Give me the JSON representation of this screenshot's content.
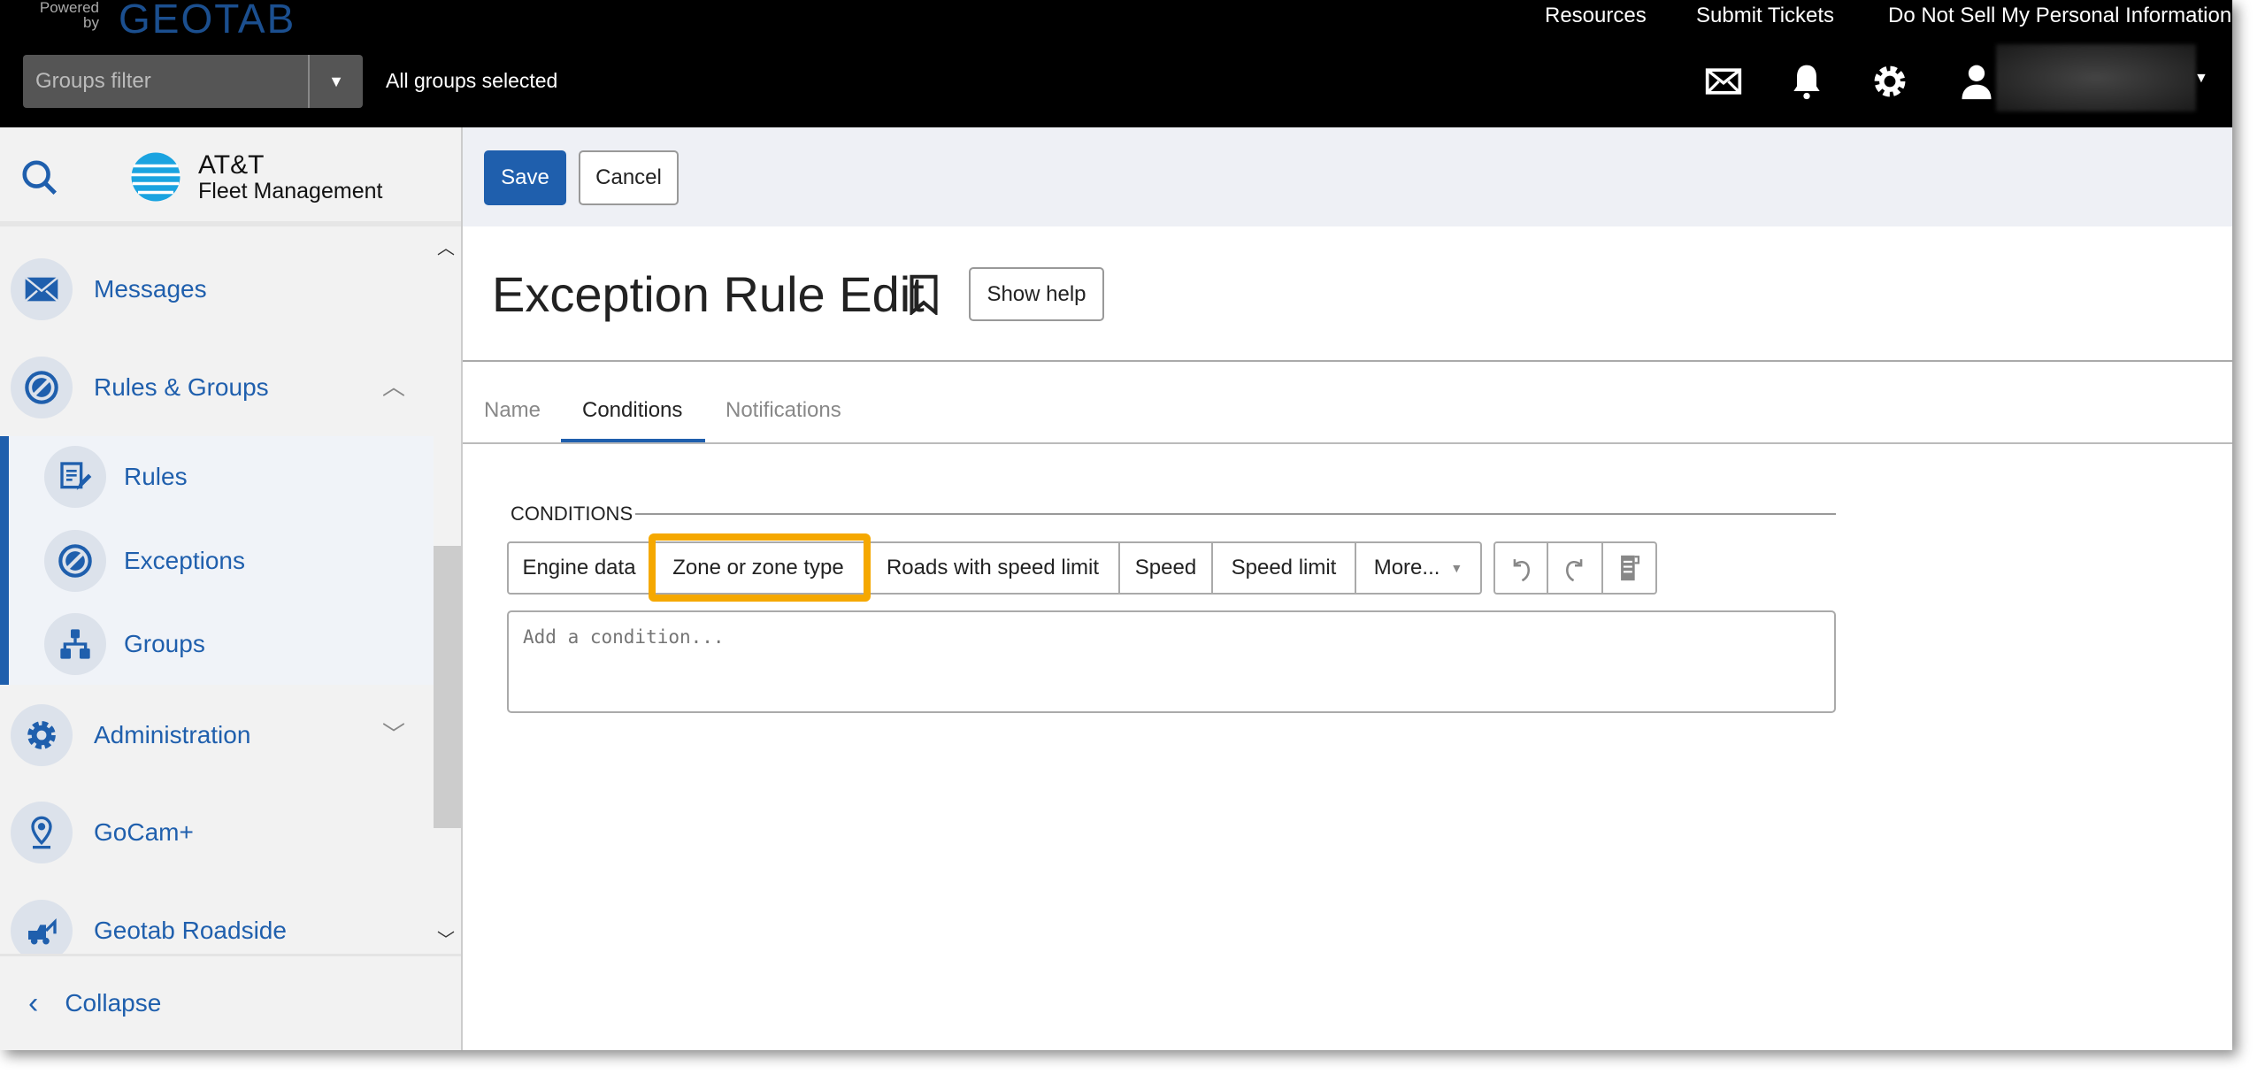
{
  "topbar": {
    "powered_by": "Powered by",
    "brand": "GEOTAB",
    "links": [
      "Resources",
      "Submit Tickets",
      "Do Not Sell My Personal Information"
    ],
    "groups_filter_placeholder": "Groups filter",
    "groups_status": "All groups selected",
    "icons": [
      "mail-icon",
      "bell-icon",
      "gear-icon",
      "user-icon"
    ]
  },
  "sidebar": {
    "logo_line1": "AT&T",
    "logo_line2": "Fleet Management",
    "items": [
      {
        "label": "Messages",
        "icon": "mail-icon"
      },
      {
        "label": "Rules & Groups",
        "icon": "exceptions-icon",
        "expanded": true
      },
      {
        "label": "Administration",
        "icon": "gear-icon"
      },
      {
        "label": "GoCam+",
        "icon": "camera-pin-icon"
      },
      {
        "label": "Geotab Roadside",
        "icon": "tow-truck-icon"
      }
    ],
    "subitems": [
      {
        "label": "Rules",
        "icon": "rule-edit-icon"
      },
      {
        "label": "Exceptions",
        "icon": "exceptions-icon"
      },
      {
        "label": "Groups",
        "icon": "hierarchy-icon"
      }
    ],
    "collapse": "Collapse"
  },
  "toolbar": {
    "save": "Save",
    "cancel": "Cancel"
  },
  "page": {
    "title": "Exception Rule Edit",
    "show_help": "Show help"
  },
  "tabs": [
    {
      "label": "Name"
    },
    {
      "label": "Conditions",
      "active": true
    },
    {
      "label": "Notifications"
    }
  ],
  "conditions": {
    "heading": "CONDITIONS",
    "buttons": [
      "Engine data",
      "Zone or zone type",
      "Roads with speed limit",
      "Speed",
      "Speed limit",
      "More..."
    ],
    "highlighted": "Zone or zone type",
    "placeholder": "Add a condition..."
  },
  "colors": {
    "accent": "#1f5fad",
    "highlight": "#f5a800",
    "topbar": "#000000"
  }
}
